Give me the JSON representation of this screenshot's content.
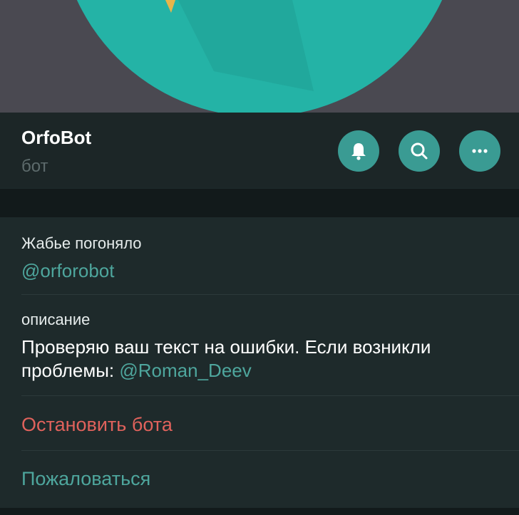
{
  "profile": {
    "name": "OrfoBot",
    "subtitle": "бот"
  },
  "actions": [
    {
      "icon": "bell-icon"
    },
    {
      "icon": "search-icon"
    },
    {
      "icon": "more-icon"
    }
  ],
  "info": {
    "username_label": "Жабье погоняло",
    "username_value": "@orforobot",
    "description_label": "описание",
    "description_text": "Проверяю ваш текст на ошибки. Если возникли проблемы: ",
    "description_mention": "@Roman_Deev"
  },
  "buttons": {
    "stop_bot": "Остановить бота",
    "report": "Пожаловаться"
  },
  "colors": {
    "accent": "#3a9b93",
    "link": "#4ea69d",
    "danger": "#e0625c",
    "avatar_teal": "#24b3a6"
  }
}
